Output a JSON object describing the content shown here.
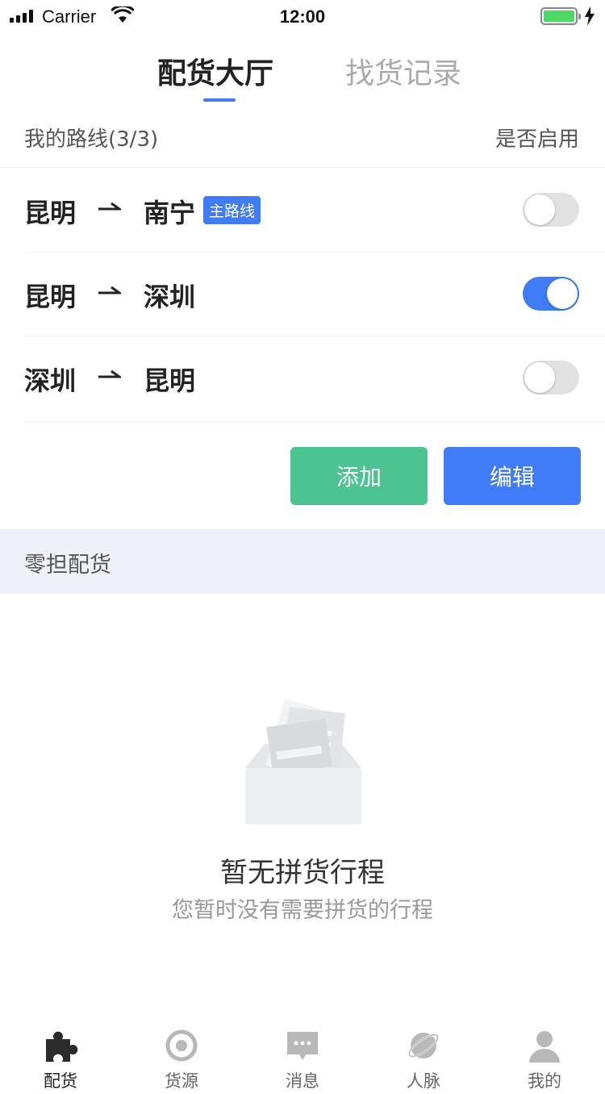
{
  "status_bar": {
    "carrier": "Carrier",
    "time": "12:00"
  },
  "tabs": [
    {
      "label": "配货大厅",
      "active": true
    },
    {
      "label": "找货记录",
      "active": false
    }
  ],
  "routes_header": {
    "title": "我的路线(3/3)",
    "enable_label": "是否启用"
  },
  "routes": [
    {
      "from": "昆明",
      "to": "南宁",
      "badge": "主路线",
      "enabled": false
    },
    {
      "from": "昆明",
      "to": "深圳",
      "badge": "",
      "enabled": true
    },
    {
      "from": "深圳",
      "to": "昆明",
      "badge": "",
      "enabled": false
    }
  ],
  "actions": {
    "add_label": "添加",
    "edit_label": "编辑"
  },
  "section": {
    "title": "零担配货"
  },
  "empty_state": {
    "title": "暂无拼货行程",
    "subtitle": "您暂时没有需要拼货的行程"
  },
  "bottom_nav": [
    {
      "label": "配货",
      "icon": "puzzle-icon",
      "active": true
    },
    {
      "label": "货源",
      "icon": "target-icon",
      "active": false
    },
    {
      "label": "消息",
      "icon": "message-icon",
      "active": false
    },
    {
      "label": "人脉",
      "icon": "planet-icon",
      "active": false
    },
    {
      "label": "我的",
      "icon": "user-icon",
      "active": false
    }
  ],
  "colors": {
    "accent": "#3f7cf6",
    "add_button": "#4cc391",
    "section_bg": "#eef2f8",
    "toggle_off": "#e1e1e1"
  }
}
